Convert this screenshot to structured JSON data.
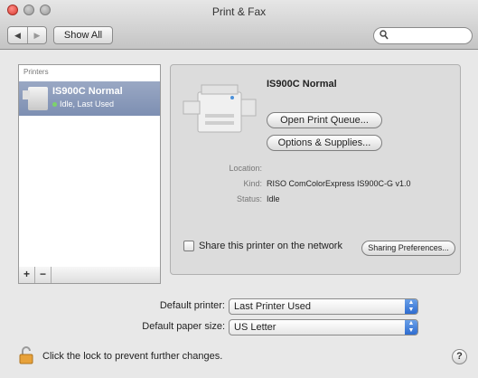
{
  "window": {
    "title": "Print & Fax"
  },
  "toolbar": {
    "back_icon": "back-arrow-icon",
    "forward_icon": "forward-arrow-icon",
    "show_all_label": "Show All",
    "search": {
      "icon": "search-icon",
      "value": ""
    }
  },
  "sidebar": {
    "header": "Printers",
    "printers": [
      {
        "name": "IS900C Normal",
        "status": "Idle, Last Used",
        "status_color": "#7cd36a"
      }
    ],
    "add_label": "+",
    "remove_label": "−"
  },
  "detail": {
    "name": "IS900C Normal",
    "open_queue_label": "Open Print Queue...",
    "options_label": "Options & Supplies...",
    "location_label": "Location:",
    "location_value": "",
    "kind_label": "Kind:",
    "kind_value": "RISO ComColorExpress IS900C-G v1.0",
    "status_label": "Status:",
    "status_value": "Idle",
    "share_label": "Share this printer on the network",
    "share_checked": false,
    "sharing_prefs_label": "Sharing Preferences..."
  },
  "defaults": {
    "printer_label": "Default printer:",
    "printer_value": "Last Printer Used",
    "paper_label": "Default paper size:",
    "paper_value": "US Letter"
  },
  "footer": {
    "lock_text": "Click the lock to prevent further changes.",
    "help_label": "?"
  },
  "colors": {
    "accent": "#2e6cd0",
    "selection": "#8797b8"
  }
}
